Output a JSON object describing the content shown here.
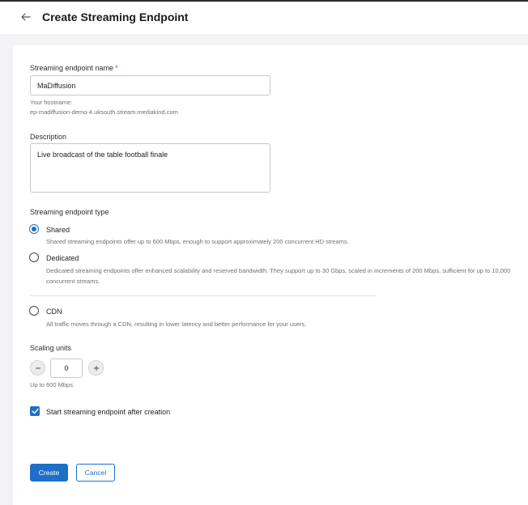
{
  "header": {
    "title": "Create Streaming Endpoint"
  },
  "form": {
    "name": {
      "label": "Streaming endpoint name",
      "required_mark": "*",
      "value": "MaDiffusion",
      "hostname_label": "Your hostname:",
      "hostname": "ep-madiffusion-demo-4.uksouth.stream.mediakind.com"
    },
    "description": {
      "label": "Description",
      "value": "Live broadcast of the table football finale"
    },
    "type": {
      "label": "Streaming endpoint type",
      "selected": "Shared",
      "options": [
        {
          "title": "Shared",
          "desc": "Shared streaming endpoints offer up to 600 Mbps, enough to support approximately 200 concurrent HD streams."
        },
        {
          "title": "Dedicated",
          "desc": "Dedicated streaming endpoints offer enhanced scalability and reserved bandwidth. They support up to 30 Gbps, scaled in increments of 200 Mbps, sufficient for up to 10,000 concurrent streams."
        },
        {
          "title": "CDN",
          "desc": "All traffic moves through a CDN, resulting in lower latency and better performance for your users."
        }
      ]
    },
    "scaling": {
      "label": "Scaling units",
      "value": "0",
      "hint": "Up to 600 Mbps"
    },
    "start_after_creation": {
      "label": "Start streaming endpoint after creation",
      "checked": true
    }
  },
  "actions": {
    "create": "Create",
    "cancel": "Cancel"
  },
  "colors": {
    "accent": "#1e6fc8",
    "required": "#d13438"
  }
}
